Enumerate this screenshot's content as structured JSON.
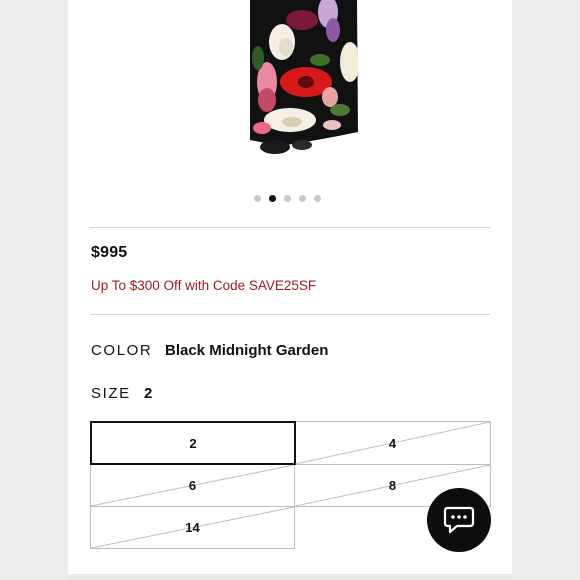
{
  "product": {
    "price": "$995",
    "promo": "Up To $300 Off with Code SAVE25SF",
    "color_label": "COLOR",
    "color_value": "Black Midnight Garden",
    "size_label": "SIZE",
    "size_value": "2"
  },
  "carousel": {
    "count": 5,
    "active_index": 1
  },
  "sizes": [
    {
      "label": "2",
      "selected": true,
      "available": true
    },
    {
      "label": "4",
      "selected": false,
      "available": false
    },
    {
      "label": "6",
      "selected": false,
      "available": false
    },
    {
      "label": "8",
      "selected": false,
      "available": false
    },
    {
      "label": "14",
      "selected": false,
      "available": false
    }
  ],
  "icons": {
    "chat": "chat-bubble-icon"
  },
  "colors": {
    "promo": "#9b1c1c",
    "chat_bg": "#0d0d0d"
  }
}
